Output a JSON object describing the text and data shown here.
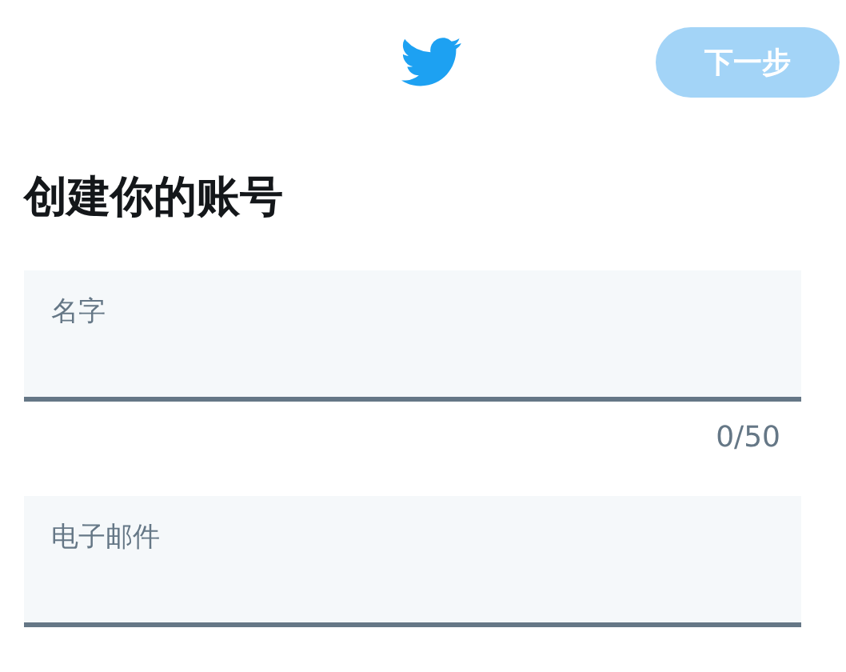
{
  "header": {
    "next_button": {
      "label": "下一步",
      "disabled": true
    }
  },
  "title": "创建你的账号",
  "fields": [
    {
      "label": "名字",
      "counter": "0/50"
    },
    {
      "label": "电子邮件"
    }
  ]
}
